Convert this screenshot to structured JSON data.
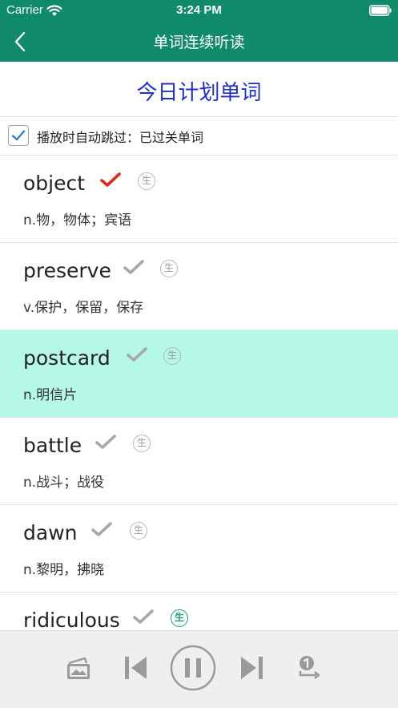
{
  "status_bar": {
    "carrier": "Carrier",
    "time": "3:24 PM"
  },
  "nav": {
    "title": "单词连续听读",
    "back_icon": "chevron-left-icon"
  },
  "plan_title": "今日计划单词",
  "autoskip": {
    "checked": true,
    "label": "播放时自动跳过：已过关单词"
  },
  "words": [
    {
      "word": "object",
      "definition": "n.物，物体；宾语",
      "badge": "生",
      "checked_color": "#e0281c",
      "active": false
    },
    {
      "word": "preserve",
      "definition": "v.保护，保留，保存",
      "badge": "生",
      "checked_color": "#a8a8a8",
      "active": false
    },
    {
      "word": "postcard",
      "definition": "n.明信片",
      "badge": "生",
      "checked_color": "#a8a8a8",
      "active": true
    },
    {
      "word": "battle",
      "definition": "n.战斗；战役",
      "badge": "生",
      "checked_color": "#a8a8a8",
      "active": false
    },
    {
      "word": "dawn",
      "definition": "n.黎明，拂晓",
      "badge": "生",
      "checked_color": "#a8a8a8",
      "active": false
    },
    {
      "word": "ridiculous",
      "definition": "",
      "badge": "生",
      "checked_color": "#a8a8a8",
      "active": false
    }
  ],
  "colors": {
    "nav_green": "#0f8a6a",
    "title_blue": "#1f2ed1",
    "active_row": "#b6f8e7",
    "new_badge_green": "#11a074"
  },
  "player": {
    "icons": [
      "cards-icon",
      "skip-previous-icon",
      "pause-icon",
      "skip-next-icon",
      "repeat-one-icon"
    ]
  }
}
